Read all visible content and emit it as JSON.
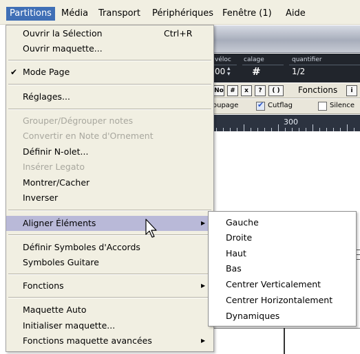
{
  "menubar": {
    "items": [
      "Partitions",
      "Média",
      "Transport",
      "Périphériques",
      "Fenêtre (1)",
      "Aide"
    ],
    "active": "Partitions"
  },
  "background": {
    "toolbar": {
      "veloc_label": "véloc",
      "veloc_value": "00",
      "calage_label": "calage",
      "calage_value": "#",
      "quantifier_label": "quantifier",
      "quantifier_value": "1/2"
    },
    "tools": {
      "btn_no": "No",
      "btn_sharp": "#",
      "btn_x": "x",
      "btn_q": "?",
      "btn_paren": "( )",
      "fonctions": "Fonctions",
      "info": "i"
    },
    "options": {
      "oupage": "oupage",
      "cutflag": "Cutflag",
      "silence": "Silence"
    },
    "ruler_mark": "300"
  },
  "main_menu": {
    "items": [
      {
        "label": "Ouvrir la Sélection",
        "shortcut": "Ctrl+R"
      },
      {
        "label": "Ouvrir maquette..."
      },
      {
        "label": "Mode Page",
        "checked": "✔"
      },
      {
        "label": "Réglages..."
      },
      {
        "label": "Grouper/Dégrouper notes",
        "disabled": true
      },
      {
        "label": "Convertir en Note d'Ornement",
        "disabled": true
      },
      {
        "label": "Définir N-olet..."
      },
      {
        "label": "Insérer Legato",
        "disabled": true
      },
      {
        "label": "Montrer/Cacher"
      },
      {
        "label": "Inverser"
      },
      {
        "label": "Aligner Éléments",
        "submenu": true
      },
      {
        "label": "Définir Symboles d'Accords"
      },
      {
        "label": "Symboles Guitare"
      },
      {
        "label": "Fonctions",
        "submenu": true
      },
      {
        "label": "Maquette Auto"
      },
      {
        "label": "Initialiser maquette..."
      },
      {
        "label": "Fonctions maquette avancées",
        "submenu": true
      }
    ]
  },
  "sub_menu": {
    "items": [
      "Gauche",
      "Droite",
      "Haut",
      "Bas",
      "Centrer Verticalement",
      "Centrer Horizontalement",
      "Dynamiques"
    ]
  },
  "colors": {
    "menubar_bg": "#f1efe2",
    "active_bg": "#3f6fb6",
    "highlight_bg": "#b9b9d8",
    "disabled_text": "#a8a79e"
  }
}
